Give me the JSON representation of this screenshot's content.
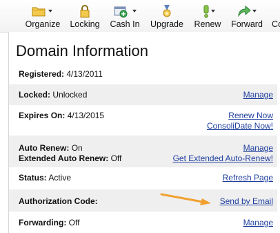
{
  "toolbar": {
    "items": [
      {
        "label": "Organize",
        "icon": "folder-icon"
      },
      {
        "label": "Locking",
        "icon": "lock-icon"
      },
      {
        "label": "Cash In",
        "icon": "cash-in-icon"
      },
      {
        "label": "Upgrade",
        "icon": "medal-icon"
      },
      {
        "label": "Renew",
        "icon": "exclamation-icon"
      },
      {
        "label": "Forward",
        "icon": "forward-arrow-icon"
      },
      {
        "label": "Co",
        "icon": "more-icon"
      }
    ]
  },
  "page_title": "Domain Information",
  "rows": {
    "registered": {
      "label": "Registered:",
      "value": "4/13/2011"
    },
    "locked": {
      "label": "Locked:",
      "value": "Unlocked",
      "action": "Manage"
    },
    "expires": {
      "label": "Expires On:",
      "value": "4/13/2015",
      "action1": "Renew Now",
      "action2": "ConsoliDate Now!"
    },
    "auto_renew": {
      "label": "Auto Renew:",
      "value": "On",
      "label2": "Extended Auto Renew:",
      "value2": "Off",
      "action1": "Manage",
      "action2": "Get Extended Auto-Renew!"
    },
    "status": {
      "label": "Status:",
      "value": "Active",
      "action": "Refresh Page"
    },
    "auth_code": {
      "label": "Authorization Code:",
      "action": "Send by Email"
    },
    "forwarding": {
      "label": "Forwarding:",
      "value": "Off",
      "action": "Manage"
    }
  },
  "colors": {
    "link": "#1f3f9f",
    "row_alt": "#efefef",
    "annotation_arrow": "#f0a030"
  }
}
